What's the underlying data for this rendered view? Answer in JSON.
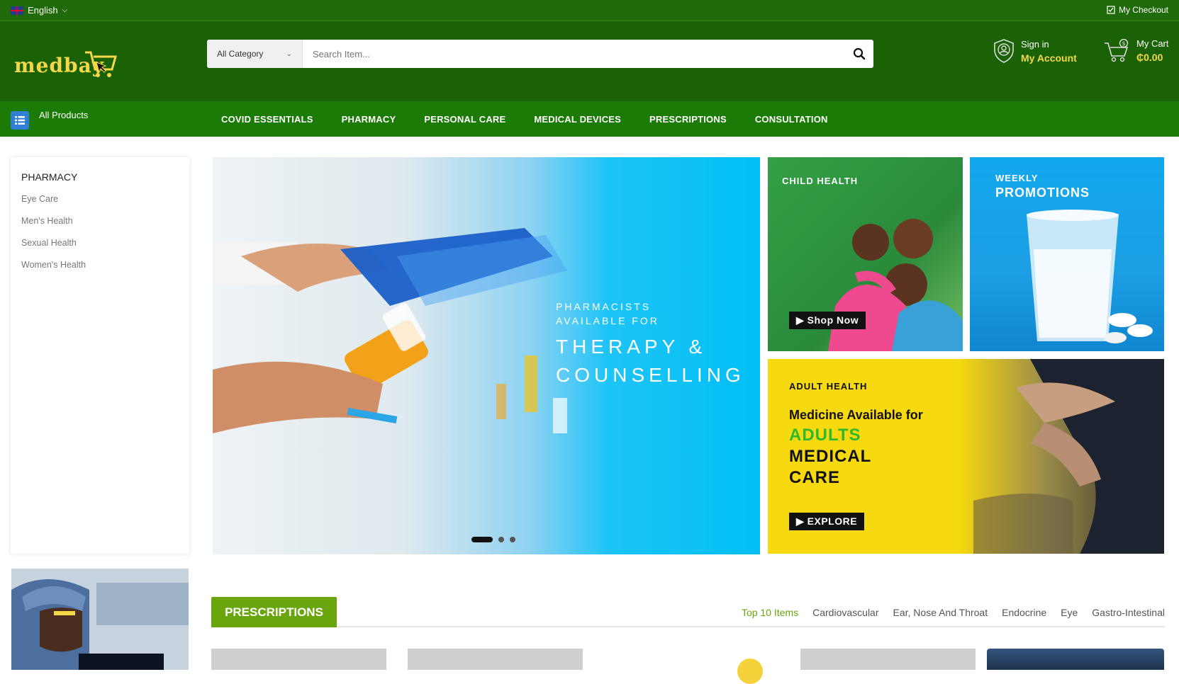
{
  "topbar": {
    "language": "English",
    "checkout": "My Checkout"
  },
  "header": {
    "logo": "medbay",
    "search_category": "All Category",
    "search_placeholder": "Search Item...",
    "signin": "Sign in",
    "account": "My Account",
    "cart_label": "My Cart",
    "cart_total": "₵0.00"
  },
  "nav": {
    "all_products": "All Products",
    "items": [
      "COVID ESSENTIALS",
      "PHARMACY",
      "PERSONAL CARE",
      "MEDICAL DEVICES",
      "PRESCRIPTIONS",
      "CONSULTATION"
    ]
  },
  "sidebar": {
    "heading": "PHARMACY",
    "items": [
      "Eye Care",
      "Men's Health",
      "Sexual Health",
      "Women's Health"
    ]
  },
  "hero": {
    "caption_small_1": "PHARMACISTS",
    "caption_small_2": "AVAILABLE FOR",
    "caption_big_1": "THERAPY &",
    "caption_big_2": "COUNSELLING",
    "slides": 3,
    "active_slide": 1
  },
  "banners": {
    "child": {
      "title": "CHILD HEALTH",
      "button": "Shop Now"
    },
    "weekly": {
      "line1": "WEEKLY",
      "line2": "PROMOTIONS"
    },
    "adult": {
      "title": "ADULT HEALTH",
      "line1": "Medicine Available for",
      "line2": "ADULTS",
      "line3": "MEDICAL",
      "line4": "CARE",
      "button": "EXPLORE"
    }
  },
  "prescriptions": {
    "title": "PRESCRIPTIONS",
    "tabs": [
      "Top 10 Items",
      "Cardiovascular",
      "Ear, Nose And Throat",
      "Endocrine",
      "Eye",
      "Gastro-Intestinal"
    ],
    "active_tab": "Top 10 Items"
  },
  "colors": {
    "brand_dark": "#1a6205",
    "nav": "#1c7a07",
    "accent_yellow": "#f5d84a",
    "section_green": "#6ba50e"
  }
}
